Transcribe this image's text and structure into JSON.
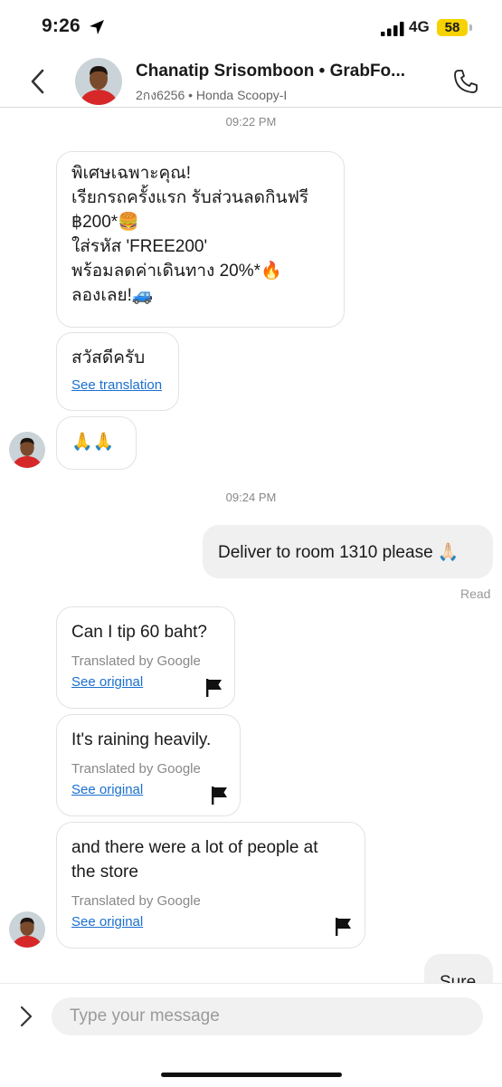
{
  "status_bar": {
    "time": "9:26",
    "network": "4G",
    "battery": "58",
    "battery_color": "#f6d200"
  },
  "header": {
    "title": "Chanatip Srisomboon • GrabFo...",
    "subtitle": "2กง6256 • Honda Scoopy-I",
    "icons": {
      "back": "back-chevron-icon",
      "call": "phone-icon",
      "avatar": "driver-avatar"
    }
  },
  "messages": {
    "ts1": "09:22 PM",
    "promo": {
      "line1": "พิเศษเฉพาะคุณ!",
      "line2": "เรียกรถครั้งแรก รับส่วนลดกินฟรี",
      "line3": "฿200*🍔",
      "line4": "ใส่รหัส 'FREE200'",
      "line5": "พร้อมลดค่าเดินทาง 20%*🔥",
      "line6": "ลองเลย!🚙"
    },
    "greet": {
      "text": "สวัสดีครับ",
      "link": "See translation"
    },
    "pray": {
      "text": "🙏🙏"
    },
    "ts2": "09:24 PM",
    "outgoing": {
      "text": "Deliver to room 1310 please 🙏🏻",
      "status": "Read"
    },
    "tip": {
      "text": "Can I tip 60 baht?",
      "note": "Translated by Google",
      "link": "See original"
    },
    "rain": {
      "text": "It's raining heavily.",
      "note": "Translated by Google",
      "link": "See original"
    },
    "crowd": {
      "line1": "and there were a lot of people at",
      "line2": "the store",
      "note": "Translated by Google",
      "link": "See original"
    },
    "sure": {
      "text": "Sure"
    }
  },
  "input": {
    "placeholder": "Type your message",
    "value": ""
  },
  "colors": {
    "link": "#1b6fcf",
    "outgoing_bubble": "#f0f0f0",
    "avatar_shirt": "#d62828"
  }
}
